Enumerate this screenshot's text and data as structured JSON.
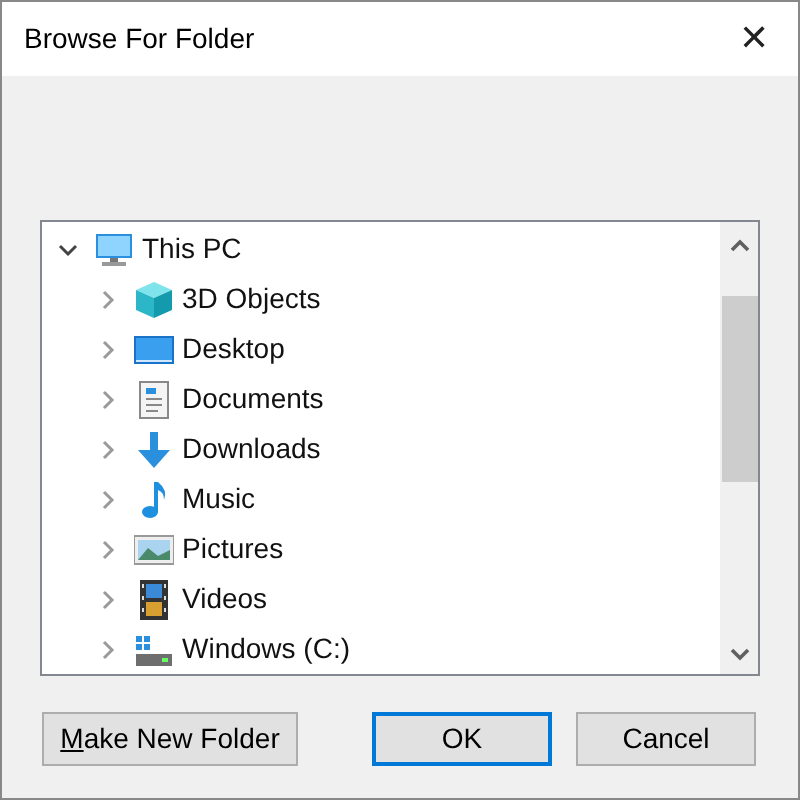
{
  "window": {
    "title": "Browse For Folder",
    "close_glyph": "✕"
  },
  "tree": {
    "label": "This PC",
    "kind": "pc",
    "expanded": true,
    "children": [
      {
        "label": "3D Objects",
        "kind": "objects3d",
        "expanded": false
      },
      {
        "label": "Desktop",
        "kind": "desktop",
        "expanded": false
      },
      {
        "label": "Documents",
        "kind": "documents",
        "expanded": false
      },
      {
        "label": "Downloads",
        "kind": "downloads",
        "expanded": false
      },
      {
        "label": "Music",
        "kind": "music",
        "expanded": false
      },
      {
        "label": "Pictures",
        "kind": "pictures",
        "expanded": false
      },
      {
        "label": "Videos",
        "kind": "videos",
        "expanded": false
      },
      {
        "label": "Windows (C:)",
        "kind": "drive",
        "expanded": false
      }
    ]
  },
  "buttons": [
    {
      "label": "Make New Folder",
      "access_key_underlined": true,
      "default": false
    },
    {
      "label": "OK",
      "default": true
    },
    {
      "label": "Cancel",
      "default": false
    }
  ]
}
